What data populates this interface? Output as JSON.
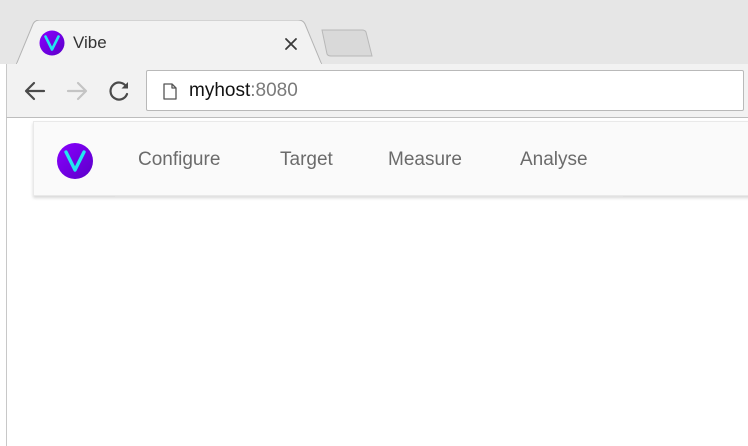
{
  "browser": {
    "tab": {
      "title": "Vibe",
      "favicon_icon": "vibe-logo-icon",
      "close_icon": "close-icon"
    },
    "new_tab_icon": "new-tab-icon",
    "toolbar": {
      "back_icon": "back-arrow-icon",
      "forward_icon": "forward-arrow-icon",
      "reload_icon": "reload-icon"
    },
    "omnibox": {
      "page_icon": "page-icon",
      "host": "myhost",
      "port": ":8080"
    }
  },
  "app": {
    "logo_icon": "vibe-logo-icon",
    "menu": [
      {
        "label": "Configure"
      },
      {
        "label": "Target"
      },
      {
        "label": "Measure"
      },
      {
        "label": "Analyse"
      }
    ]
  },
  "colors": {
    "logo_gradient_start": "#7a00ff",
    "logo_gradient_end": "#5a00c8",
    "logo_letter": "#22e6f0",
    "tabstrip_bg": "#e6e6e6",
    "toolbar_bg": "#f2f2f2",
    "menu_text": "#6b6b6b"
  }
}
